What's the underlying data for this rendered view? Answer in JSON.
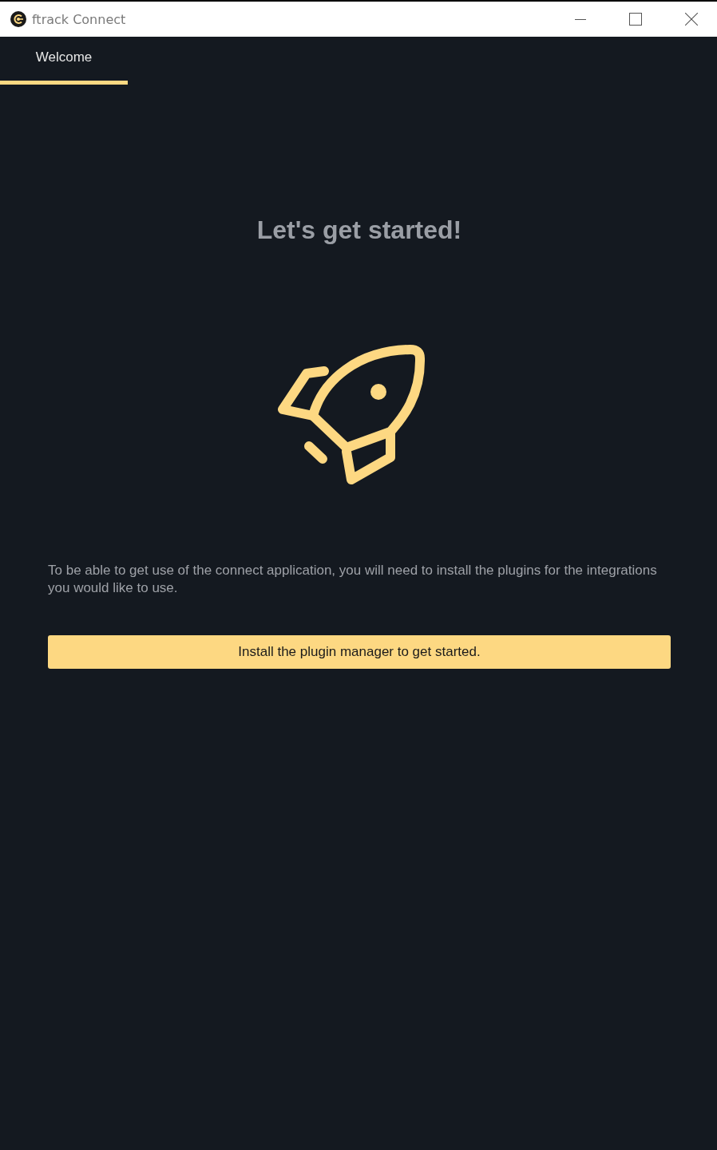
{
  "window": {
    "title": "ftrack Connect"
  },
  "tabs": [
    {
      "label": "Welcome",
      "selected": true
    }
  ],
  "heading": "Let's get started!",
  "description": "To be able to get use of the connect application, you will need to install the plugins for the integrations you would like to use.",
  "button": "Install the plugin manager to get started."
}
